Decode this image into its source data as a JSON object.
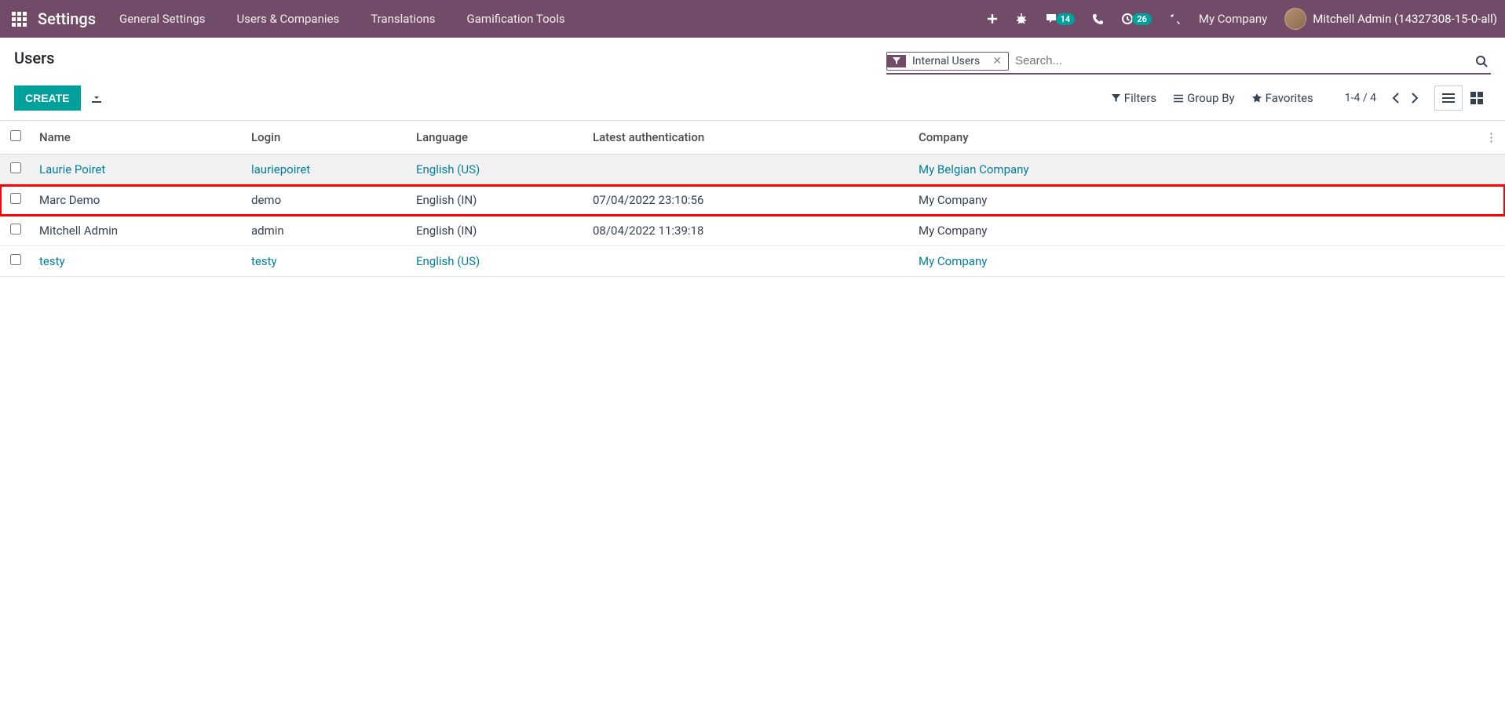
{
  "navbar": {
    "title": "Settings",
    "menu": [
      "General Settings",
      "Users & Companies",
      "Translations",
      "Gamification Tools"
    ],
    "messaging_badge": "14",
    "activities_badge": "26",
    "company": "My Company",
    "user": "Mitchell Admin (14327308-15-0-all)"
  },
  "control_panel": {
    "breadcrumb": "Users",
    "search_facet": "Internal Users",
    "search_placeholder": "Search...",
    "create_label": "CREATE",
    "filters_label": "Filters",
    "groupby_label": "Group By",
    "favorites_label": "Favorites",
    "pager": "1-4 / 4"
  },
  "table": {
    "headers": {
      "name": "Name",
      "login": "Login",
      "language": "Language",
      "latest_auth": "Latest authentication",
      "company": "Company"
    },
    "rows": [
      {
        "name": "Laurie Poiret",
        "login": "lauriepoiret",
        "language": "English (US)",
        "latest_auth": "",
        "company": "My Belgian Company",
        "style": "link",
        "hover": true,
        "highlight": false
      },
      {
        "name": "Marc Demo",
        "login": "demo",
        "language": "English (IN)",
        "latest_auth": "07/04/2022 23:10:56",
        "company": "My Company",
        "style": "normal",
        "hover": false,
        "highlight": true
      },
      {
        "name": "Mitchell Admin",
        "login": "admin",
        "language": "English (IN)",
        "latest_auth": "08/04/2022 11:39:18",
        "company": "My Company",
        "style": "normal",
        "hover": false,
        "highlight": false
      },
      {
        "name": "testy",
        "login": "testy",
        "language": "English (US)",
        "latest_auth": "",
        "company": "My Company",
        "style": "link",
        "hover": false,
        "highlight": false
      }
    ]
  }
}
